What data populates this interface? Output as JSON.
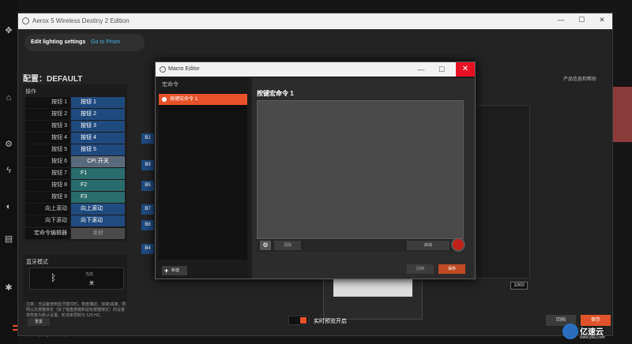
{
  "window": {
    "title": "Aerox 5 Wireless Destiny 2 Edition",
    "minimize": "—",
    "maximize": "☐",
    "close": "✕"
  },
  "tabs": {
    "edit_lighting": "Edit lighting settings",
    "go_to_prism": "Go to Prism"
  },
  "config_title": "配置：DEFAULT",
  "product_info": "产品信息和帮助",
  "operations": {
    "header": "操作",
    "rows": [
      {
        "label": "按钮 1",
        "value": "按钮 1"
      },
      {
        "label": "按钮 2",
        "value": "按钮 2"
      },
      {
        "label": "按钮 3",
        "value": "按钮 3"
      },
      {
        "label": "按钮 4",
        "value": "按钮 4"
      },
      {
        "label": "按钮 5",
        "value": "按钮 5"
      },
      {
        "label": "按钮 6",
        "value": "CPI 开关"
      },
      {
        "label": "按钮 7",
        "value": "F1"
      },
      {
        "label": "按钮 8",
        "value": "F2"
      },
      {
        "label": "按钮 9",
        "value": "F3"
      },
      {
        "label": "向上滚动",
        "value": "向上滚动"
      },
      {
        "label": "向下滚动",
        "value": "向下滚动"
      },
      {
        "label": "宏命令编辑器",
        "value": "发射"
      }
    ]
  },
  "bluetooth": {
    "title": "蓝牙模式",
    "state_label": "当前",
    "state_value": "关",
    "note": "注意：当设备使用蓝牙模式时，角度捕捉、加速/减速、照明以及按键绑定（除了键盘按键和鼠标按键绑定）的设置将恢复为默认设置。轮询率限制为 125 HZ。",
    "reset": "重置"
  },
  "button_chips": [
    "B1",
    "B9",
    "B5",
    "B7",
    "B8",
    "B4"
  ],
  "live_preview": "实时预览开启",
  "main_actions": {
    "revert": "回档",
    "save": "保存"
  },
  "background_actions": {
    "revert": "回档",
    "save": "保存"
  },
  "dpi_value": "1000",
  "feedback": "给予反馈",
  "macro_editor": {
    "title": "Macro Editor",
    "list_header": "宏命令",
    "items": [
      "按键宏命令 1"
    ],
    "new_button": "新建",
    "macro_name": "按键宏命令 1",
    "clear": "清除",
    "start": "启动",
    "revert": "回档",
    "save": "保存"
  },
  "watermark": {
    "text": "亿速云",
    "url": "www.yisu.com"
  },
  "colors": {
    "accent": "#e8522a",
    "blue": "#1f4a7e",
    "teal": "#2a6b6b",
    "link": "#4ab0e6"
  }
}
